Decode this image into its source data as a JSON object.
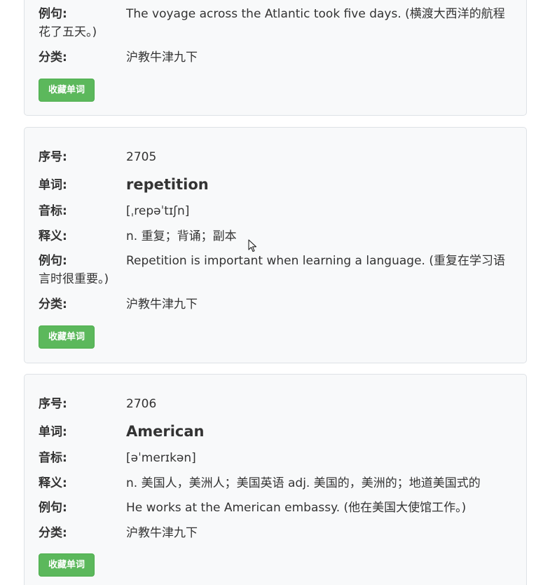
{
  "labels": {
    "index": "序号:",
    "word": "单词:",
    "phonetic": "音标:",
    "meaning": "释义:",
    "example": "例句:",
    "category": "分类:"
  },
  "button_label": "收藏单词",
  "accent_color": "#5cb85c",
  "cards": [
    {
      "example": "The voyage across the Atlantic took five days. (横渡大西洋的航程花了五天。)",
      "category": "沪教牛津九下"
    },
    {
      "index": "2705",
      "word": "repetition",
      "phonetic": "[ˌrepəˈtɪʃn]",
      "meaning": "n. 重复；背诵；副本",
      "example": "Repetition is important when learning a language. (重复在学习语言时很重要。)",
      "category": "沪教牛津九下"
    },
    {
      "index": "2706",
      "word": "American",
      "phonetic": "[əˈmerɪkən]",
      "meaning": "n. 美国人，美洲人；美国英语 adj. 美国的，美洲的；地道美国式的",
      "example": "He works at the American embassy. (他在美国大使馆工作。)",
      "category": "沪教牛津九下"
    }
  ]
}
